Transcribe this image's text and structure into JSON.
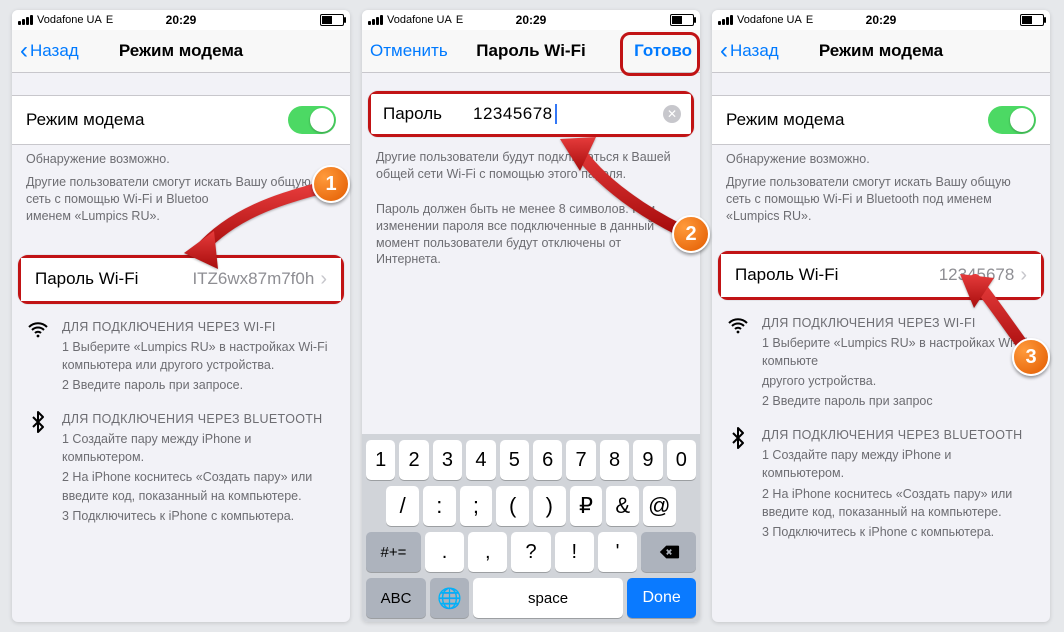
{
  "status": {
    "carrier": "Vodafone UA",
    "net": "E",
    "time": "20:29"
  },
  "nav1": {
    "back": "Назад",
    "title": "Режим модема"
  },
  "nav2": {
    "cancel": "Отменить",
    "title": "Пароль Wi-Fi",
    "done": "Готово"
  },
  "hotspot": {
    "toggle_label": "Режим модема",
    "disc_title": "Обнаружение возможно.",
    "disc_body": "Другие пользователи смогут искать Вашу общую сеть с помощью Wi-Fi и Bluetooth под именем «Lumpics RU».",
    "disc_body_short": "Другие пользователи смогут искать Вашу общую сеть с помощью Wi-Fi и Bluetoo",
    "pwd_label": "Пароль Wi-Fi",
    "pwd_value_old": "ITZ6wx87m7f0h",
    "pwd_value_new": "12345678"
  },
  "pwd_screen": {
    "field_label": "Пароль",
    "field_value": "12345678",
    "help1": "Другие пользователи будут подключаться к Вашей общей сети Wi-Fi с помощью этого пароля.",
    "help2": "Пароль должен быть не менее 8 символов. При изменении пароля все подключенные в данный момент пользователи будут отключены от Интернета."
  },
  "instr_wifi": {
    "hdr": "ДЛЯ ПОДКЛЮЧЕНИЯ ЧЕРЕЗ WI-FI",
    "l1": "1 Выберите «Lumpics RU» в настройках Wi-Fi компьютера или другого устройства.",
    "l2": "2 Введите пароль при запросе."
  },
  "instr_bt": {
    "hdr": "ДЛЯ ПОДКЛЮЧЕНИЯ ЧЕРЕЗ BLUETOOTH",
    "l1": "1 Создайте пару между iPhone и компьютером.",
    "l2": "2 На iPhone коснитесь «Создать пару» или введите код, показанный на компьютере.",
    "l3": "3 Подключитесь к iPhone с компьютера."
  },
  "instr_wifi_cut": {
    "l1": "1 Выберите «Lumpics RU» в настройках Wi-Fi компьюте",
    "l2a": "другого устройства.",
    "l2": "2 Введите пароль при запрос"
  },
  "keyboard": {
    "row1": [
      "1",
      "2",
      "3",
      "4",
      "5",
      "6",
      "7",
      "8",
      "9",
      "0"
    ],
    "row2": [
      "-",
      "/",
      ":",
      ";",
      "(",
      ")",
      "₽",
      "&",
      "@",
      "\""
    ],
    "row3_switch": "#+=",
    "row3": [
      ".",
      ",",
      "?",
      "!",
      "'"
    ],
    "abc": "ABC",
    "space": "space",
    "done": "Done",
    "globe": "🌐"
  },
  "badges": {
    "b1": "1",
    "b2": "2",
    "b3": "3"
  }
}
